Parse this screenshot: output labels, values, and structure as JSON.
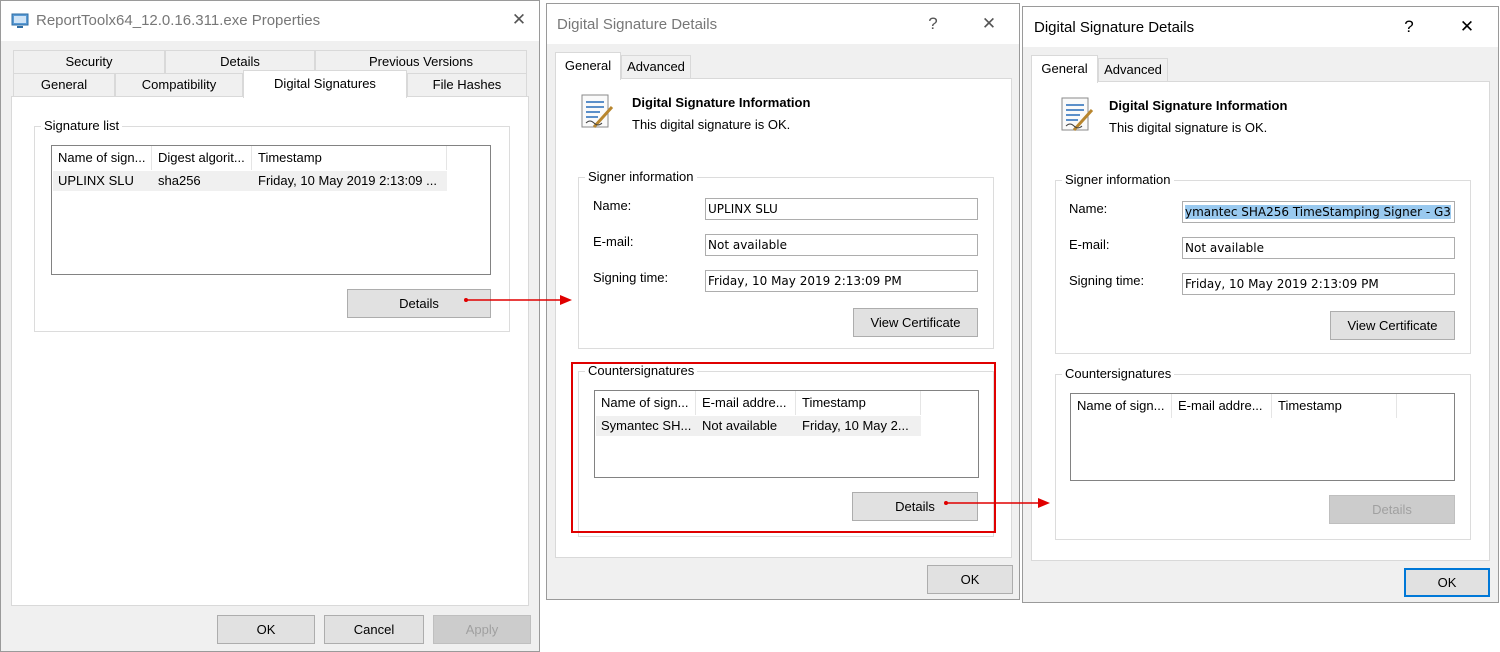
{
  "win1": {
    "title": "ReportToolx64_12.0.16.311.exe Properties",
    "tabs": [
      "Security",
      "Details",
      "Previous Versions",
      "General",
      "Compatibility",
      "Digital Signatures",
      "File Hashes"
    ],
    "group_label": "Signature list",
    "columns": [
      "Name of sign...",
      "Digest algorit...",
      "Timestamp"
    ],
    "row": [
      "UPLINX SLU",
      "sha256",
      "Friday, 10 May 2019 2:13:09 ..."
    ],
    "details_label": "Details",
    "ok_label": "OK",
    "cancel_label": "Cancel",
    "apply_label": "Apply"
  },
  "win2": {
    "title": "Digital Signature Details",
    "help": "?",
    "close": "✕",
    "tabs": [
      "General",
      "Advanced"
    ],
    "info_title": "Digital Signature Information",
    "info_text": "This digital signature is OK.",
    "signer_label": "Signer information",
    "name_label": "Name:",
    "email_label": "E-mail:",
    "time_label": "Signing time:",
    "name_value": "UPLINX SLU",
    "email_value": "Not available",
    "time_value": "Friday, 10 May 2019 2:13:09 PM",
    "view_cert": "View Certificate",
    "counter_label": "Countersignatures",
    "columns": [
      "Name of sign...",
      "E-mail addre...",
      "Timestamp"
    ],
    "row": [
      "Symantec SH...",
      "Not available",
      "Friday, 10 May 2..."
    ],
    "details_label": "Details",
    "ok_label": "OK"
  },
  "win3": {
    "title": "Digital Signature Details",
    "help": "?",
    "close": "✕",
    "tabs": [
      "General",
      "Advanced"
    ],
    "info_title": "Digital Signature Information",
    "info_text": "This digital signature is OK.",
    "signer_label": "Signer information",
    "name_label": "Name:",
    "email_label": "E-mail:",
    "time_label": "Signing time:",
    "name_value": "ymantec SHA256 TimeStamping Signer - G3",
    "email_value": "Not available",
    "time_value": "Friday, 10 May 2019 2:13:09 PM",
    "view_cert": "View Certificate",
    "counter_label": "Countersignatures",
    "columns": [
      "Name of sign...",
      "E-mail addre...",
      "Timestamp"
    ],
    "details_label": "Details",
    "ok_label": "OK"
  },
  "win1_close": "✕",
  "colors": {
    "highlight": "#e00000",
    "selection": "#99c9ef",
    "accent": "#0078d7"
  }
}
